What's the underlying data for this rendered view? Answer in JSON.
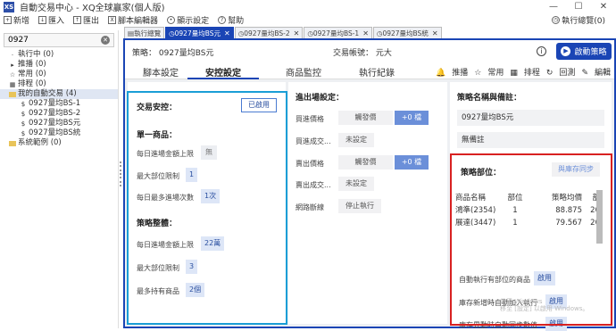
{
  "app": {
    "title": "自動交易中心 - XQ全球贏家(個人版)",
    "logo": "XS"
  },
  "window_buttons": [
    "—",
    "☐",
    "✕"
  ],
  "menu": {
    "items": [
      "新增",
      "匯入",
      "匯出",
      "腳本編輯器",
      "顯示設定",
      "幫助"
    ],
    "right": "執行總覽(0)"
  },
  "sidebar": {
    "search_value": "0927",
    "tree": [
      {
        "label": "執行中 (0)",
        "indent": 0,
        "icon": "run-icon"
      },
      {
        "label": "推播 (0)",
        "indent": 0,
        "icon": "expand-icon"
      },
      {
        "label": "常用 (0)",
        "indent": 0,
        "icon": "star-icon"
      },
      {
        "label": "排程 (0)",
        "indent": 0,
        "icon": "calendar-icon"
      },
      {
        "label": "我的自動交易 (4)",
        "indent": 0,
        "icon": "folder-icon",
        "selected": true
      },
      {
        "label": "0927量均BS-1",
        "indent": 1,
        "icon": "strategy-icon"
      },
      {
        "label": "0927量均BS-2",
        "indent": 1,
        "icon": "strategy-icon"
      },
      {
        "label": "0927量均BS元",
        "indent": 1,
        "icon": "strategy-icon"
      },
      {
        "label": "0927量均BS統",
        "indent": 1,
        "icon": "strategy-icon"
      },
      {
        "label": "系統範例 (0)",
        "indent": 0,
        "icon": "folder-icon"
      }
    ]
  },
  "tabs": [
    {
      "label": "執行總覽",
      "closable": false,
      "active": false
    },
    {
      "label": "0927量均BS元",
      "closable": true,
      "active": true
    },
    {
      "label": "0927量均BS-2",
      "closable": true,
      "active": false
    },
    {
      "label": "0927量均BS-1",
      "closable": true,
      "active": false
    },
    {
      "label": "0927量均BS統",
      "closable": true,
      "active": false
    }
  ],
  "header": {
    "strategy": "策略：  0927量均BS元",
    "account": "交易帳號：  元大",
    "start_button": "啟動策略"
  },
  "subtabs": [
    "腳本設定",
    "安控設定",
    "商品監控",
    "執行紀錄"
  ],
  "tools": [
    "推播",
    "常用",
    "排程",
    "回測",
    "編輯"
  ],
  "col1": {
    "title": "交易安控：",
    "toggle": "已啟用",
    "single_title": "單一商品：",
    "single": [
      {
        "label": "每日進場金額上限",
        "value": "無",
        "gray": true
      },
      {
        "label": "最大部位限制",
        "value": "1"
      },
      {
        "label": "每日最多進場次數",
        "value": "1次"
      }
    ],
    "overall_title": "策略整體：",
    "overall": [
      {
        "label": "每日進場金額上限",
        "value": "22萬"
      },
      {
        "label": "最大部位限制",
        "value": "3"
      },
      {
        "label": "最多持有商品",
        "value": "2個"
      }
    ]
  },
  "col2": {
    "title": "進出場設定：",
    "rows": [
      {
        "label": "買進價格",
        "a": "觸發價",
        "b": "+0 檔"
      },
      {
        "label": "買進成交...",
        "single": "未設定"
      },
      {
        "label": "賣出價格",
        "a": "觸發價",
        "b": "+0 檔"
      },
      {
        "label": "賣出成交...",
        "single": "未設定"
      },
      {
        "label": "網路斷線",
        "single": "停止執行"
      }
    ]
  },
  "col3": {
    "title": "策略名稱與備註：",
    "name": "0927量均BS元",
    "note": "無備註",
    "position_title": "策略部位：",
    "sync_button": "與庫存同步",
    "table_headers": [
      "商品名稱",
      "部位",
      "策略均價",
      "部"
    ],
    "table_rows": [
      [
        "鴻準(2354)",
        "1",
        "88.875",
        "20"
      ],
      [
        "展達(3447)",
        "1",
        "79.567",
        "20"
      ]
    ],
    "options": [
      {
        "label": "自動執行有部位的商品",
        "button": "啟用"
      },
      {
        "label": "庫存新增時自動加入執行",
        "button": "啟用"
      },
      {
        "label": "庫存異動時自動同步數值",
        "button": "啟用"
      }
    ],
    "watermark": [
      "啟用 Windows",
      "移至 [設定] 以啟用 Windows。"
    ]
  },
  "colors": {
    "accent": "#1a45b5",
    "cyan": "#1a9ed6",
    "red": "#d82121"
  }
}
